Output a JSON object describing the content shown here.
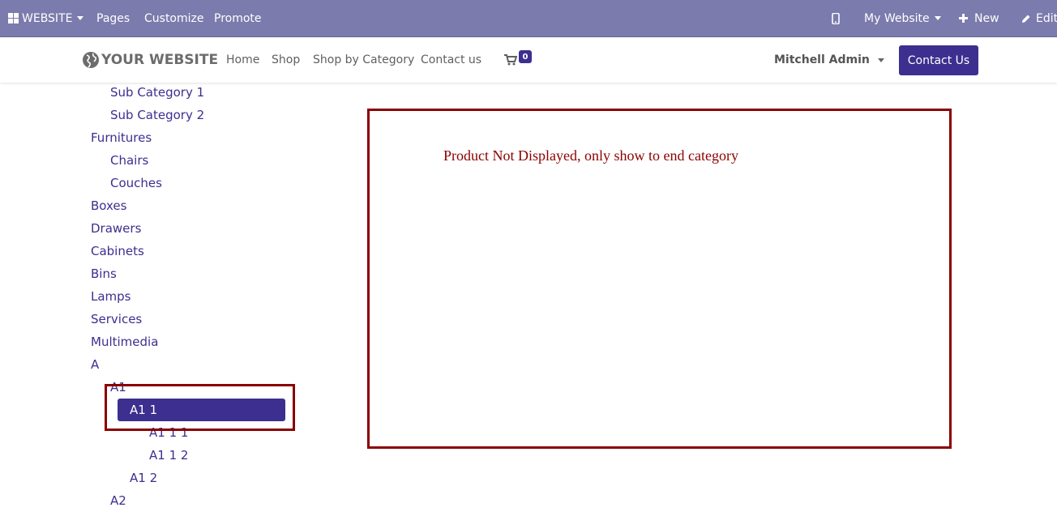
{
  "topbar": {
    "website_label": "WEBSITE",
    "pages": "Pages",
    "customize": "Customize",
    "promote": "Promote",
    "my_website": "My Website",
    "new": "New",
    "edit": "Edit"
  },
  "navbar": {
    "brand": "YOUR WEBSITE",
    "links": [
      "Home",
      "Shop",
      "Shop by Category",
      "Contact us"
    ],
    "cart_count": "0",
    "user": "Mitchell Admin",
    "contact_button": "Contact Us"
  },
  "sidebar": {
    "categories": [
      "Sub Category 1",
      "Sub Category 2",
      "Furnitures",
      "Chairs",
      "Couches",
      "Boxes",
      "Drawers",
      "Cabinets",
      "Bins",
      "Lamps",
      "Services",
      "Multimedia",
      "A",
      "A1",
      "A1 1",
      "A1 1 1",
      "A1 1 2",
      "A1 2",
      "A2"
    ]
  },
  "annotation": {
    "note": "Product Not Displayed, only show to end category"
  },
  "colors": {
    "topbar": "#7c7bad",
    "primary": "#3c2f8f",
    "annotation": "#8b0000"
  }
}
